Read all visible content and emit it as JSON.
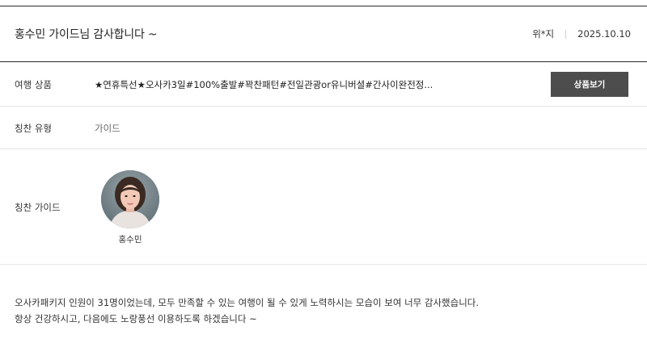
{
  "header": {
    "title": "홍수민 가이드님 감사합니다 ~",
    "author": "위*지",
    "date": "2025.10.10"
  },
  "product": {
    "label": "여행 상품",
    "name": "★연휴특선★오사카3일#100%출발#꽉찬패턴#전일관광or유니버셜#간사이완전정...",
    "button_label": "상품보기"
  },
  "praise_type": {
    "label": "칭찬 유형",
    "value": "가이드"
  },
  "praise_guide": {
    "label": "칭찬 가이드",
    "guide_name": "홍수민"
  },
  "review": {
    "line1": "오사카패키지 인원이 31명이었는데, 모두 만족할 수 있는 여행이 될 수 있게 노력하시는 모습이 보여 너무 감사했습니다.",
    "line2": "항상 건강하시고, 다음에도 노랑풍선 이용하도록 하겠습니다 ~"
  },
  "colors": {
    "button_bg": "#4d4d4d",
    "rule": "#2b2b2b",
    "divider": "#e6e6e6"
  }
}
